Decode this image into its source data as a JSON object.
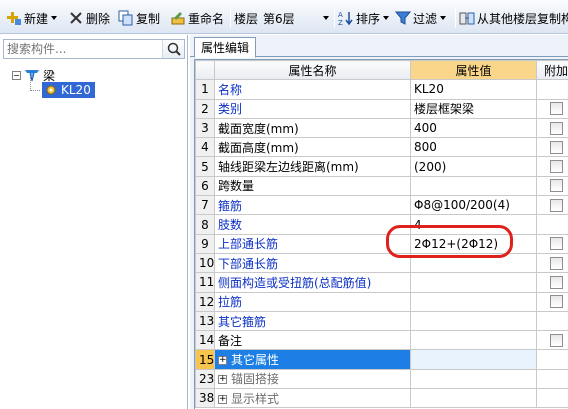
{
  "toolbar": {
    "new_label": "新建",
    "delete_label": "删除",
    "copy_label": "复制",
    "rename_label": "重命名",
    "floor_label": "楼层",
    "floor_value": "第6层",
    "sort_label": "排序",
    "filter_label": "过滤",
    "copy_from_floor_label": "从其他楼层复制构"
  },
  "search": {
    "placeholder": "搜索构件..."
  },
  "tree": {
    "root_label": "梁",
    "child_label": "KL20"
  },
  "tab": {
    "label": "属性编辑"
  },
  "grid": {
    "headers": {
      "name": "属性名称",
      "value": "属性值",
      "extra": "附加"
    },
    "rows": [
      {
        "num": "1",
        "name": "名称",
        "value": "KL20",
        "blue": true,
        "checkbox": false
      },
      {
        "num": "2",
        "name": "类别",
        "value": "楼层框架梁",
        "blue": true,
        "checkbox": true
      },
      {
        "num": "3",
        "name": "截面宽度(mm)",
        "value": "400",
        "blue": false,
        "checkbox": true
      },
      {
        "num": "4",
        "name": "截面高度(mm)",
        "value": "800",
        "blue": false,
        "checkbox": true
      },
      {
        "num": "5",
        "name": "轴线距梁左边线距离(mm)",
        "value": "(200)",
        "blue": false,
        "checkbox": true
      },
      {
        "num": "6",
        "name": "跨数量",
        "value": "",
        "blue": false,
        "checkbox": true
      },
      {
        "num": "7",
        "name": "箍筋",
        "value": "Φ8@100/200(4)",
        "blue": true,
        "checkbox": true
      },
      {
        "num": "8",
        "name": "肢数",
        "value": "4",
        "blue": true,
        "checkbox": false
      },
      {
        "num": "9",
        "name": "上部通长筋",
        "value": "2Φ12+(2Φ12)",
        "blue": true,
        "checkbox": true
      },
      {
        "num": "10",
        "name": "下部通长筋",
        "value": "",
        "blue": true,
        "checkbox": true
      },
      {
        "num": "11",
        "name": "侧面构造或受扭筋(总配筋值)",
        "value": "",
        "blue": true,
        "checkbox": true
      },
      {
        "num": "12",
        "name": "拉筋",
        "value": "",
        "blue": true,
        "checkbox": true
      },
      {
        "num": "13",
        "name": "其它箍筋",
        "value": "",
        "blue": true,
        "checkbox": false
      },
      {
        "num": "14",
        "name": "备注",
        "value": "",
        "blue": false,
        "checkbox": true
      }
    ],
    "group_rows": [
      {
        "num": "15",
        "name": "其它属性"
      },
      {
        "num": "23",
        "name": "锚固搭接"
      },
      {
        "num": "38",
        "name": "显示样式"
      }
    ]
  },
  "colors": {
    "selection": "#3168d5",
    "header_highlight": "#f9d68a",
    "annotation": "#e0201c",
    "link_text": "#0b2fc4"
  }
}
